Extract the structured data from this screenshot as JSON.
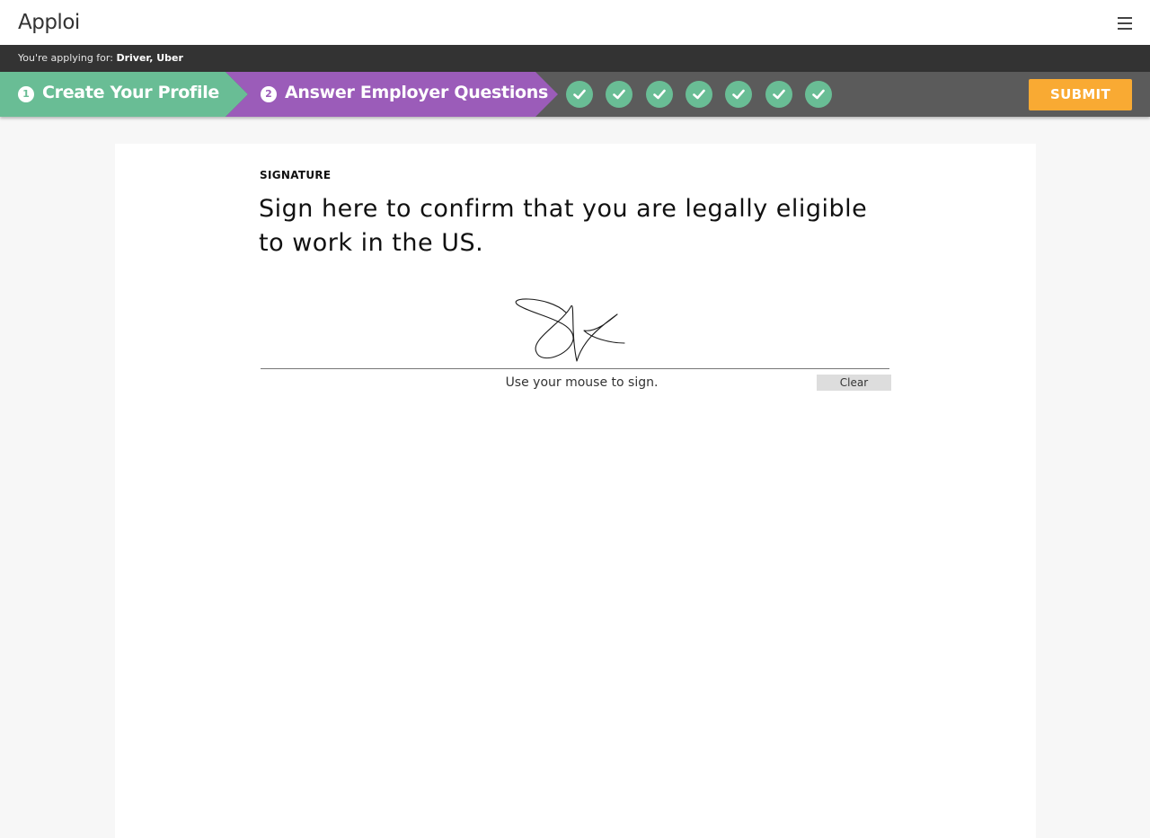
{
  "header": {
    "logo_text": "Apploi"
  },
  "applying": {
    "prefix": "You're applying for:",
    "job": "Driver, Uber"
  },
  "steps": [
    {
      "number": "1",
      "label": "Create Your Profile",
      "color": "#69bd95"
    },
    {
      "number": "2",
      "label": "Answer Employer Questions",
      "color": "#9b5cb9"
    }
  ],
  "completed_checks": 7,
  "submit_label": "SUBMIT",
  "question": {
    "label": "SIGNATURE",
    "text": "Sign here to confirm that you are legally eligible to work in the US."
  },
  "signature": {
    "hint": "Use your mouse to sign.",
    "clear_label": "Clear"
  },
  "colors": {
    "accent_green": "#69bd95",
    "accent_purple": "#9b5cb9",
    "submit_orange": "#f9aa33",
    "bar_dark": "#333333"
  }
}
